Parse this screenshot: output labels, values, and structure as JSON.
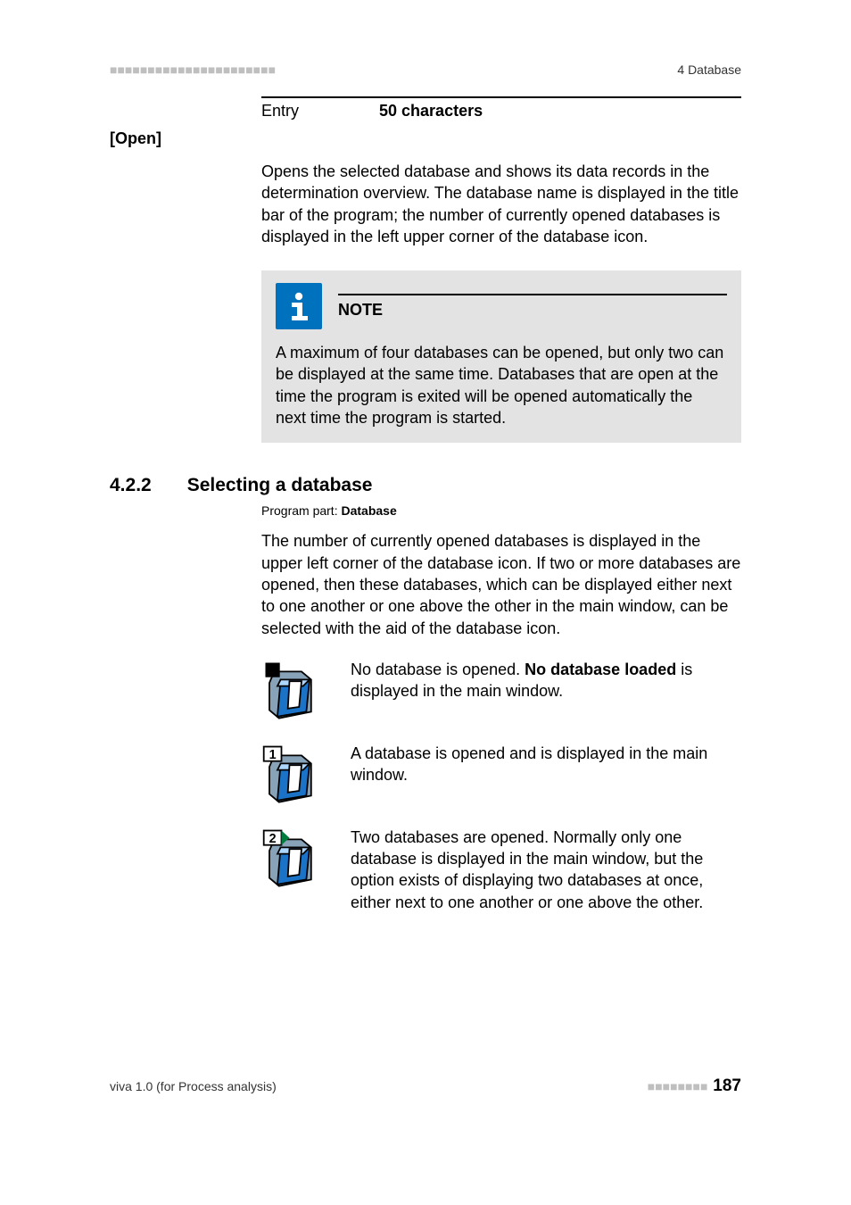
{
  "header": {
    "chapter": "4 Database",
    "dashes": "■■■■■■■■■■■■■■■■■■■■■■"
  },
  "entry": {
    "label": "Entry",
    "value": "50 characters"
  },
  "open": {
    "label": "[Open]",
    "body": "Opens the selected database and shows its data records in the determination overview. The database name is displayed in the title bar of the program; the number of currently opened databases is displayed in the left upper corner of the database icon."
  },
  "note": {
    "title": "NOTE",
    "body": "A maximum of four databases can be opened, but only two can be displayed at the same time. Databases that are open at the time the program is exited will be opened automatically the next time the program is started."
  },
  "section": {
    "number": "4.2.2",
    "title": "Selecting a database"
  },
  "program_part": {
    "key": "Program part: ",
    "value": "Database"
  },
  "intro": "The number of currently opened databases is displayed in the upper left corner of the database icon. If two or more databases are opened, then these databases, which can be displayed either next to one another or one above the other in the main window, can be selected with the aid of the database icon.",
  "rows": [
    {
      "badge": null,
      "pre": "No database is opened. ",
      "bold": "No database loaded",
      "post": " is displayed in the main window."
    },
    {
      "badge": "1",
      "text": "A database is opened and is displayed in the main window."
    },
    {
      "badge": "2",
      "text": "Two databases are opened. Normally only one database is displayed in the main window, but the option exists of displaying two databases at once, either next to one another or one above the other."
    }
  ],
  "footer": {
    "left": "viva 1.0 (for Process analysis)",
    "dashes": "■■■■■■■■",
    "page": "187"
  }
}
